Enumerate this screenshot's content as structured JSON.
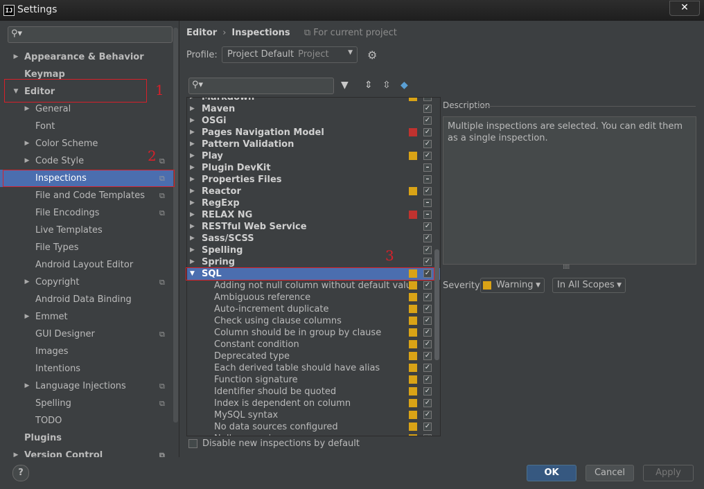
{
  "window": {
    "title": "Settings",
    "app_icon_text": "IJ",
    "close_glyph": "✕"
  },
  "sidebar": {
    "search_placeholder": "",
    "items": [
      {
        "label": "Appearance & Behavior",
        "bold": true,
        "arrow": "right",
        "level": 0
      },
      {
        "label": "Keymap",
        "bold": true,
        "arrow": "none",
        "level": 0
      },
      {
        "label": "Editor",
        "bold": true,
        "arrow": "down",
        "level": 0
      },
      {
        "label": "General",
        "bold": false,
        "arrow": "right",
        "level": 1
      },
      {
        "label": "Font",
        "bold": false,
        "arrow": "none",
        "level": 1
      },
      {
        "label": "Color Scheme",
        "bold": false,
        "arrow": "right",
        "level": 1
      },
      {
        "label": "Code Style",
        "bold": false,
        "arrow": "right",
        "level": 1,
        "project_icon": true
      },
      {
        "label": "Inspections",
        "bold": false,
        "arrow": "none",
        "level": 1,
        "project_icon": true,
        "selected": true
      },
      {
        "label": "File and Code Templates",
        "bold": false,
        "arrow": "none",
        "level": 1,
        "project_icon": true
      },
      {
        "label": "File Encodings",
        "bold": false,
        "arrow": "none",
        "level": 1,
        "project_icon": true
      },
      {
        "label": "Live Templates",
        "bold": false,
        "arrow": "none",
        "level": 1
      },
      {
        "label": "File Types",
        "bold": false,
        "arrow": "none",
        "level": 1
      },
      {
        "label": "Android Layout Editor",
        "bold": false,
        "arrow": "none",
        "level": 1
      },
      {
        "label": "Copyright",
        "bold": false,
        "arrow": "right",
        "level": 1,
        "project_icon": true
      },
      {
        "label": "Android Data Binding",
        "bold": false,
        "arrow": "none",
        "level": 1
      },
      {
        "label": "Emmet",
        "bold": false,
        "arrow": "right",
        "level": 1
      },
      {
        "label": "GUI Designer",
        "bold": false,
        "arrow": "none",
        "level": 1,
        "project_icon": true
      },
      {
        "label": "Images",
        "bold": false,
        "arrow": "none",
        "level": 1
      },
      {
        "label": "Intentions",
        "bold": false,
        "arrow": "none",
        "level": 1
      },
      {
        "label": "Language Injections",
        "bold": false,
        "arrow": "right",
        "level": 1,
        "project_icon": true
      },
      {
        "label": "Spelling",
        "bold": false,
        "arrow": "none",
        "level": 1,
        "project_icon": true
      },
      {
        "label": "TODO",
        "bold": false,
        "arrow": "none",
        "level": 1
      },
      {
        "label": "Plugins",
        "bold": true,
        "arrow": "none",
        "level": 0
      },
      {
        "label": "Version Control",
        "bold": true,
        "arrow": "right",
        "level": 0,
        "project_icon": true
      }
    ]
  },
  "header": {
    "crumb_editor": "Editor",
    "crumb_sep": "›",
    "crumb_page": "Inspections",
    "scope_note": "For current project"
  },
  "profile": {
    "label": "Profile:",
    "value": "Project Default",
    "value_scope": "Project"
  },
  "inspections": {
    "search_placeholder": "",
    "rows": [
      {
        "label": "Markdown",
        "type": "group",
        "severity": "warning",
        "check": "checked"
      },
      {
        "label": "Maven",
        "type": "group",
        "severity": "none",
        "check": "checked"
      },
      {
        "label": "OSGi",
        "type": "group",
        "severity": "none",
        "check": "checked"
      },
      {
        "label": "Pages Navigation Model",
        "type": "group",
        "severity": "error",
        "check": "checked"
      },
      {
        "label": "Pattern Validation",
        "type": "group",
        "severity": "none",
        "check": "checked"
      },
      {
        "label": "Play",
        "type": "group",
        "severity": "warning",
        "check": "checked"
      },
      {
        "label": "Plugin DevKit",
        "type": "group",
        "severity": "none",
        "check": "partial"
      },
      {
        "label": "Properties Files",
        "type": "group",
        "severity": "none",
        "check": "partial"
      },
      {
        "label": "Reactor",
        "type": "group",
        "severity": "warning",
        "check": "checked"
      },
      {
        "label": "RegExp",
        "type": "group",
        "severity": "none",
        "check": "partial"
      },
      {
        "label": "RELAX NG",
        "type": "group",
        "severity": "error",
        "check": "partial"
      },
      {
        "label": "RESTful Web Service",
        "type": "group",
        "severity": "none",
        "check": "checked"
      },
      {
        "label": "Sass/SCSS",
        "type": "group",
        "severity": "none",
        "check": "checked"
      },
      {
        "label": "Spelling",
        "type": "group",
        "severity": "none",
        "check": "checked"
      },
      {
        "label": "Spring",
        "type": "group",
        "severity": "none",
        "check": "checked"
      },
      {
        "label": "SQL",
        "type": "group",
        "severity": "warning",
        "check": "checked",
        "selected": true,
        "expanded": true
      },
      {
        "label": "Adding not null column without default value",
        "type": "leaf",
        "severity": "warning",
        "check": "checked"
      },
      {
        "label": "Ambiguous reference",
        "type": "leaf",
        "severity": "warning",
        "check": "checked"
      },
      {
        "label": "Auto-increment duplicate",
        "type": "leaf",
        "severity": "warning",
        "check": "checked"
      },
      {
        "label": "Check using clause columns",
        "type": "leaf",
        "severity": "warning",
        "check": "checked"
      },
      {
        "label": "Column should be in group by clause",
        "type": "leaf",
        "severity": "warning",
        "check": "checked"
      },
      {
        "label": "Constant condition",
        "type": "leaf",
        "severity": "warning",
        "check": "checked"
      },
      {
        "label": "Deprecated type",
        "type": "leaf",
        "severity": "warning",
        "check": "checked"
      },
      {
        "label": "Each derived table should have alias",
        "type": "leaf",
        "severity": "warning",
        "check": "checked"
      },
      {
        "label": "Function signature",
        "type": "leaf",
        "severity": "warning",
        "check": "checked"
      },
      {
        "label": "Identifier should be quoted",
        "type": "leaf",
        "severity": "warning",
        "check": "checked"
      },
      {
        "label": "Index is dependent on column",
        "type": "leaf",
        "severity": "warning",
        "check": "checked"
      },
      {
        "label": "MySQL syntax",
        "type": "leaf",
        "severity": "warning",
        "check": "checked"
      },
      {
        "label": "No data sources configured",
        "type": "leaf",
        "severity": "warning",
        "check": "checked"
      },
      {
        "label": "Null comparison",
        "type": "leaf",
        "severity": "warning",
        "check": "checked"
      }
    ],
    "disable_new_label": "Disable new inspections by default"
  },
  "description": {
    "title": "Description",
    "text": "Multiple inspections are selected. You can edit them as a single inspection."
  },
  "severity": {
    "label": "Severity:",
    "value": "Warning",
    "scope": "In All Scopes"
  },
  "buttons": {
    "help": "?",
    "ok": "OK",
    "cancel": "Cancel",
    "apply": "Apply"
  },
  "annotations": [
    "1",
    "2",
    "3"
  ],
  "colors": {
    "warning": "#d9a316",
    "error": "#c0322f",
    "selection": "#4b6eaf",
    "annotation": "#d8202a",
    "background": "#3c3f41"
  }
}
